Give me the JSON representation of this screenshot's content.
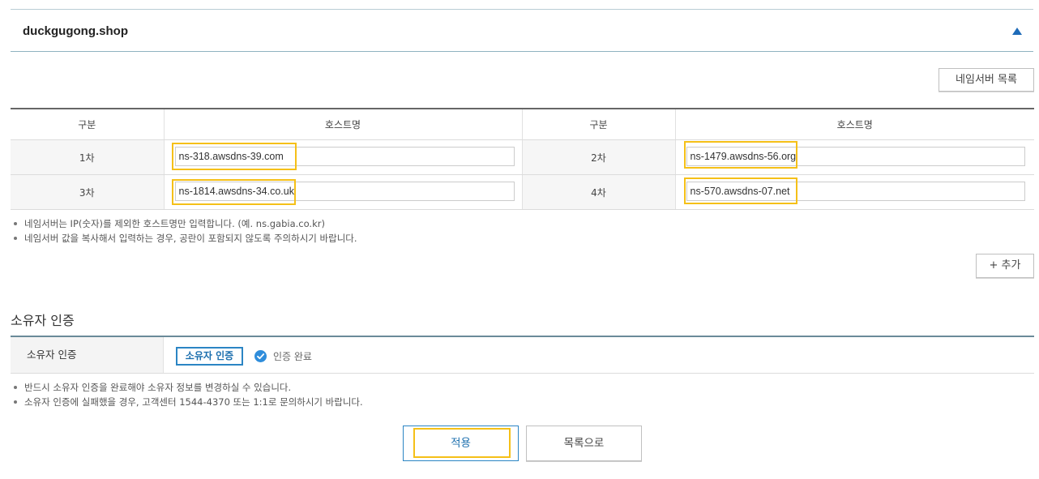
{
  "domain": {
    "name": "duckgugong.shop",
    "toggle_icon": "triangle-up-icon",
    "accent": "#1e6bb8"
  },
  "nameserver": {
    "list_button": "네임서버 목록",
    "headers": {
      "division": "구분",
      "hostname": "호스트명"
    },
    "rows": [
      {
        "left_label": "1차",
        "left_value": "ns-318.awsdns-39.com",
        "right_label": "2차",
        "right_value": "ns-1479.awsdns-56.org"
      },
      {
        "left_label": "3차",
        "left_value": "ns-1814.awsdns-34.co.uk",
        "right_label": "4차",
        "right_value": "ns-570.awsdns-07.net"
      }
    ],
    "notes": [
      "네임서버는 IP(숫자)를 제외한 호스트명만 입력합니다. (예. ns.gabia.co.kr)",
      "네임서버 값을 복사해서 입력하는 경우, 공란이 포함되지 않도록 주의하시기 바랍니다."
    ],
    "add_button": "+ 추가",
    "highlight_color": "#f5c018"
  },
  "owner_auth": {
    "section_title": "소유자 인증",
    "row_label": "소유자 인증",
    "button": "소유자 인증",
    "status_icon": "check-circle-icon",
    "status": "인증 완료",
    "notes": [
      "반드시 소유자 인증을 완료해야 소유자 정보를 변경하실 수 있습니다.",
      "소유자 인증에 실패했을 경우, 고객센터 1544-4370 또는 1:1로 문의하시기 바랍니다."
    ]
  },
  "actions": {
    "apply": "적용",
    "back_to_list": "목록으로"
  }
}
